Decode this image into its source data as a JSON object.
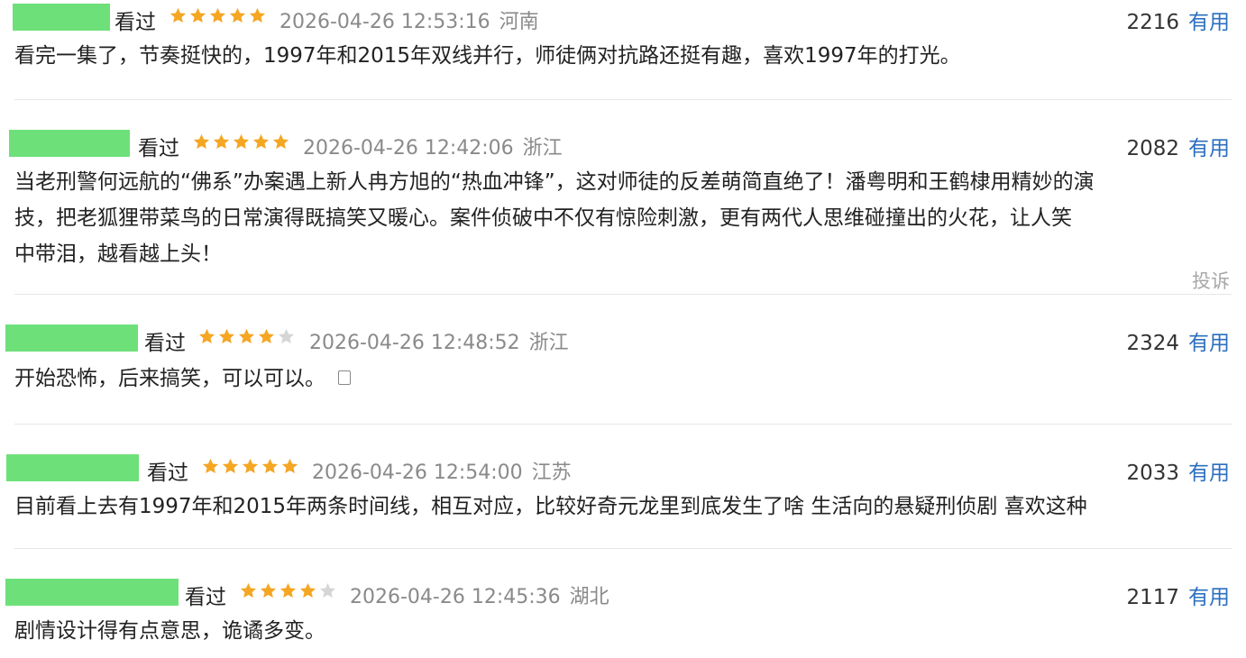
{
  "comments": [
    {
      "watched": "看过",
      "rating": 5,
      "time": "2026-04-26 12:53:16",
      "location": "河南",
      "votes": "2216",
      "useful_label": "有用",
      "content": "看完一集了，节奏挺快的，1997年和2015年双线并行，师徒俩对抗路还挺有趣，喜欢1997年的打光。"
    },
    {
      "watched": "看过",
      "rating": 5,
      "time": "2026-04-26 12:42:06",
      "location": "浙江",
      "votes": "2082",
      "useful_label": "有用",
      "content_lines": [
        "当老刑警何远航的“佛系”办案遇上新人冉方旭的“热血冲锋”，这对师徒的反差萌简直绝了！潘粤明和王鹤棣用精妙的演",
        "技，把老狐狸带菜鸟的日常演得既搞笑又暖心。案件侦破中不仅有惊险刺激，更有两代人思维碰撞出的火花，让人笑",
        "中带泪，越看越上头！"
      ],
      "report_label": "投诉"
    },
    {
      "watched": "看过",
      "rating": 4,
      "time": "2026-04-26 12:48:52",
      "location": "浙江",
      "votes": "2324",
      "useful_label": "有用",
      "content": "开始恐怖，后来搞笑，可以可以。",
      "emoji_icon": "emoji-placeholder-icon"
    },
    {
      "watched": "看过",
      "rating": 5,
      "time": "2026-04-26 12:54:00",
      "location": "江苏",
      "votes": "2033",
      "useful_label": "有用",
      "content": "目前看上去有1997年和2015年两条时间线，相互对应，比较好奇元龙里到底发生了啥 生活向的悬疑刑侦剧 喜欢这种"
    },
    {
      "watched": "看过",
      "rating": 4,
      "time": "2026-04-26 12:45:36",
      "location": "湖北",
      "votes": "2117",
      "useful_label": "有用",
      "content": "剧情设计得有点意思，诡谲多变。"
    }
  ],
  "colors": {
    "avatar_redaction": "#6ee07a",
    "star_filled": "#f5a623",
    "star_empty": "#d6d6d6",
    "link_blue": "#2c6fbf",
    "meta_gray": "#8a8a8a"
  }
}
